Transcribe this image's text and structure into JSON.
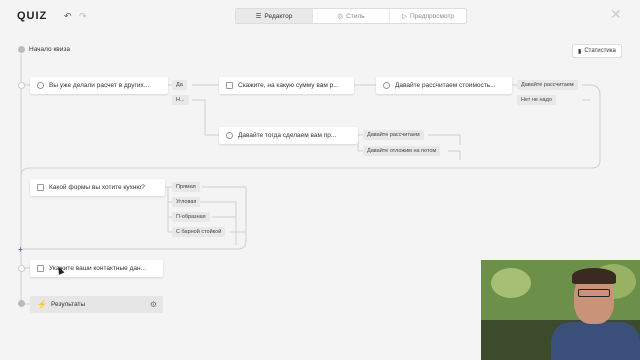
{
  "topbar": {
    "logo": "QUIZ",
    "tabs": [
      {
        "label": "Редактор",
        "icon": "sliders-icon"
      },
      {
        "label": "Стиль",
        "icon": "palette-icon"
      },
      {
        "label": "Предпросмотр",
        "icon": "play-icon"
      }
    ],
    "stats_label": "Статистика"
  },
  "canvas": {
    "start_label": "Начало квиза",
    "nodes": [
      "Вы уже делали расчет в других...",
      "Скажите, на какую сумму вам р...",
      "Давайте рассчитаем стоимость...",
      "Давайте тогда сделаем вам пр...",
      "Какой формы вы хотите кухню?",
      "Укажите ваши контактные дан..."
    ],
    "result_label": "Результаты",
    "chips": {
      "yes": "Да",
      "no": "Н...",
      "calc1": "Давайте рассчитаем",
      "not_needed": "Нет не надо",
      "calc2": "Давайте рассчитаем",
      "postpone": "Давайте отложим на потом",
      "straight": "Прямая",
      "corner": "Угловая",
      "u_shape": "П-образная",
      "bar": "С барной стойкой"
    },
    "plus": "+"
  }
}
